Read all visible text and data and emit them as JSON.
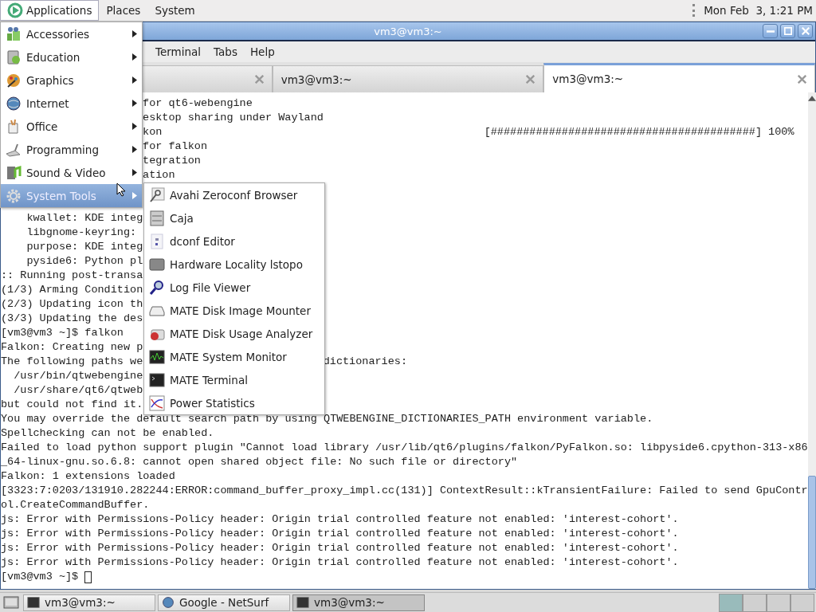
{
  "top_panel": {
    "menus": [
      {
        "label": "Applications",
        "selected": true
      },
      {
        "label": "Places",
        "selected": false
      },
      {
        "label": "System",
        "selected": false
      }
    ],
    "clock": "Mon Feb  3, 1:21 PM"
  },
  "window": {
    "title": "vm3@vm3:~"
  },
  "menubar": [
    "Terminal",
    "Tabs",
    "Help"
  ],
  "tabs": [
    {
      "selected": false
    },
    {
      "label": "vm3@vm3:~",
      "selected": false
    },
    {
      "label": "vm3@vm3:~",
      "selected": true
    }
  ],
  "terminal": {
    "lines_above_menu": [
      {
        "parts": [
          {
            "text": "for qt6-webengine",
            "kind": "after_menu"
          }
        ]
      },
      {
        "parts": [
          {
            "text": "esktop sharing under Wayland",
            "kind": "after_menu"
          }
        ]
      },
      {
        "parts": [
          {
            "text": "kon",
            "kind": "after_menu"
          },
          {
            "text": "[#########################################] 100%",
            "kind": "end"
          }
        ]
      },
      {
        "parts": [
          {
            "text": "for falkon",
            "kind": "after_menu"
          }
        ]
      },
      {
        "parts": [
          {
            "text": "tegration",
            "kind": "after_menu"
          }
        ]
      },
      {
        "parts": [
          {
            "text": "ation",
            "kind": "after_menu"
          }
        ]
      }
    ],
    "lines": [
      {
        "parts": [
          {
            "text": "    kwallet: KDE integ",
            "kind": "start"
          }
        ]
      },
      {
        "parts": [
          {
            "text": "    libgnome-keyring:",
            "kind": "start"
          }
        ]
      },
      {
        "parts": [
          {
            "text": "    purpose: KDE integ",
            "kind": "start"
          }
        ]
      },
      {
        "parts": [
          {
            "text": "    pyside6: Python pl",
            "kind": "start"
          }
        ]
      },
      {
        "parts": [
          {
            "text": ":: Running post-transa",
            "kind": "start"
          }
        ]
      },
      {
        "parts": [
          {
            "text": "(1/3) Arming Condition",
            "kind": "start"
          }
        ]
      },
      {
        "parts": [
          {
            "text": "(2/3) Updating icon th",
            "kind": "start"
          }
        ]
      },
      {
        "parts": [
          {
            "text": "(3/3) Updating the des",
            "kind": "start"
          }
        ]
      },
      {
        "parts": [
          {
            "text": "[vm3@vm3 ~]$ falkon",
            "kind": "start"
          }
        ]
      },
      {
        "parts": [
          {
            "text": "Falkon: Creating new p",
            "kind": "start"
          }
        ]
      },
      {
        "parts": [
          {
            "text": "The following paths we",
            "kind": "start"
          },
          {
            "text": "dictionaries:",
            "kind": "after_submenu"
          }
        ]
      },
      {
        "parts": [
          {
            "text": "  /usr/bin/qtwebengine",
            "kind": "start"
          }
        ]
      },
      {
        "parts": [
          {
            "text": "  /usr/share/qt6/qtweb",
            "kind": "start"
          }
        ]
      },
      {
        "parts": [
          {
            "text": "but could not find it.",
            "kind": "start"
          }
        ]
      },
      {
        "parts": [
          {
            "text": "You may override the default search path by using QTWEBENGINE_DICTIONARIES_PATH environment variable.",
            "kind": "start"
          }
        ]
      },
      {
        "parts": [
          {
            "text": "Spellchecking can not be enabled.",
            "kind": "start"
          }
        ]
      },
      {
        "parts": [
          {
            "text": "Failed to load python support plugin \"Cannot load library /usr/lib/qt6/plugins/falkon/PyFalkon.so: libpyside6.cpython-313-x86",
            "kind": "start"
          }
        ]
      },
      {
        "parts": [
          {
            "text": "_64-linux-gnu.so.6.8: cannot open shared object file: No such file or directory\"",
            "kind": "start"
          }
        ]
      },
      {
        "parts": [
          {
            "text": "Falkon: 1 extensions loaded",
            "kind": "start"
          }
        ]
      },
      {
        "parts": [
          {
            "text": "[3323:7:0203/131910.282244:ERROR:command_buffer_proxy_impl.cc(131)] ContextResult::kTransientFailure: Failed to send GpuContr",
            "kind": "start"
          }
        ]
      },
      {
        "parts": [
          {
            "text": "ol.CreateCommandBuffer.",
            "kind": "start"
          }
        ]
      },
      {
        "parts": [
          {
            "text": "js: Error with Permissions-Policy header: Origin trial controlled feature not enabled: 'interest-cohort'.",
            "kind": "start"
          }
        ]
      },
      {
        "parts": [
          {
            "text": "js: Error with Permissions-Policy header: Origin trial controlled feature not enabled: 'interest-cohort'.",
            "kind": "start"
          }
        ]
      },
      {
        "parts": [
          {
            "text": "js: Error with Permissions-Policy header: Origin trial controlled feature not enabled: 'interest-cohort'.",
            "kind": "start"
          }
        ]
      },
      {
        "parts": [
          {
            "text": "js: Error with Permissions-Policy header: Origin trial controlled feature not enabled: 'interest-cohort'.",
            "kind": "start"
          }
        ]
      },
      {
        "parts": [
          {
            "text": "[vm3@vm3 ~]$",
            "kind": "start"
          }
        ],
        "cursor": true
      }
    ]
  },
  "applications_menu": {
    "items": [
      {
        "label": "Accessories",
        "selected": false
      },
      {
        "label": "Education",
        "selected": false
      },
      {
        "label": "Graphics",
        "selected": false
      },
      {
        "label": "Internet",
        "selected": false
      },
      {
        "label": "Office",
        "selected": false
      },
      {
        "label": "Programming",
        "selected": false
      },
      {
        "label": "Sound & Video",
        "selected": false
      },
      {
        "label": "System Tools",
        "selected": true
      }
    ]
  },
  "system_tools_menu": {
    "items": [
      "Avahi Zeroconf Browser",
      "Caja",
      "dconf Editor",
      "Hardware Locality lstopo",
      "Log File Viewer",
      "MATE Disk Image Mounter",
      "MATE Disk Usage Analyzer",
      "MATE System Monitor",
      "MATE Terminal",
      "Power Statistics"
    ]
  },
  "taskbar": {
    "buttons": [
      {
        "label": "vm3@vm3:~",
        "selected": false
      },
      {
        "label": "Google - NetSurf",
        "selected": false
      },
      {
        "label": "vm3@vm3:~",
        "selected": true
      }
    ],
    "workspaces": [
      {
        "selected": true
      },
      {
        "selected": false
      },
      {
        "selected": false
      },
      {
        "selected": false
      }
    ]
  }
}
